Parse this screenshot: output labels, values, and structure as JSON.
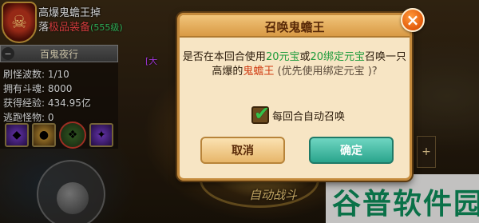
{
  "boss_banner": {
    "line1": "高爆鬼蟾王掉",
    "line2_prefix": "落",
    "line2_red": "极品装备",
    "line2_count": "(555级)"
  },
  "level_tag": "[大",
  "info_panel": {
    "title": "百鬼夜行",
    "collapse_icon": "−",
    "stats": [
      "刷怪波数: 1/10",
      "拥有斗魂: 8000",
      "获得经验: 434.95亿",
      "逃跑怪物: 0"
    ]
  },
  "dialog": {
    "title": "召唤鬼蟾王",
    "close_icon": "×",
    "msg_part1": "是否在本回合使用",
    "msg_hl1": "20元宝",
    "msg_part2": "或",
    "msg_hl2": "20绑定元宝",
    "msg_part3": "召唤一只",
    "msg_part4": "高爆的",
    "msg_boss": "鬼蟾王",
    "msg_part5": "(优先使用绑定元宝 )?",
    "auto_label": "每回合自动召唤",
    "auto_checked": true,
    "cancel_label": "取消",
    "ok_label": "确定"
  },
  "auto_battle": "自动战斗",
  "right_button": "+",
  "watermark": "谷普软件园",
  "colors": {
    "highlight_green": "#1c9a3a",
    "boss_red": "#d03a10",
    "ok_teal": "#2aa48c",
    "dialog_bg": "#f7e5c4"
  }
}
